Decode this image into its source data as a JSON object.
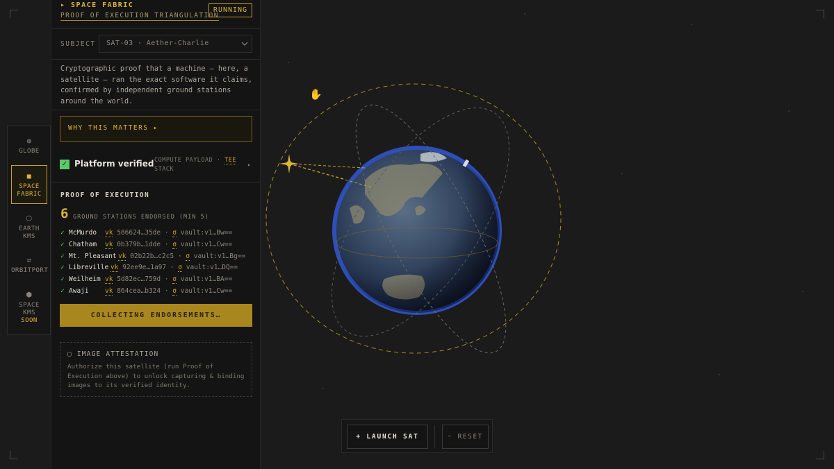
{
  "header": {
    "title": "▸ SPACE FABRIC",
    "subtitle": "PROOF OF EXECUTION TRIANGULATION",
    "status": "RUNNING"
  },
  "rail": {
    "items": [
      {
        "label": "GLOBE",
        "icon": "globe-icon",
        "glyph": "◍"
      },
      {
        "label": "SPACE FABRIC",
        "icon": "fabric-icon",
        "glyph": "■"
      },
      {
        "label": "EARTH KMS",
        "icon": "hexagon-icon",
        "glyph": "⬡"
      },
      {
        "label": "ORBITPORT",
        "icon": "swap-icon",
        "glyph": "⇄"
      },
      {
        "label": "SPACE KMS",
        "icon": "hexagon-filled-icon",
        "glyph": "⬢",
        "tag": "SOON"
      }
    ]
  },
  "subject": {
    "label": "SUBJECT",
    "value": "SAT-03 · Aether-Charlie"
  },
  "description": "Cryptographic proof that a machine — here, a satellite — ran the exact software it claims, confirmed by independent ground stations around the world.",
  "why_button": "WHY THIS MATTERS ▸",
  "platform": {
    "label": "Platform verified",
    "meta_prefix": "COMPUTE PAYLOAD ·",
    "meta_tee": "TEE",
    "meta_suffix": "STACK"
  },
  "proof": {
    "title": "PROOF OF EXECUTION",
    "count": "6",
    "count_label": "GROUND STATIONS ENDORSED (MIN 5)",
    "stations": [
      {
        "name": "McMurdo",
        "vk": "586624…35de",
        "vault": "vault:v1…Bw=="
      },
      {
        "name": "Chatham",
        "vk": "0b379b…1dde",
        "vault": "vault:v1…Cw=="
      },
      {
        "name": "Mt. Pleasant",
        "vk": "02b22b…c2c5",
        "vault": "vault:v1…Bg=="
      },
      {
        "name": "Libreville",
        "vk": "92ee9e…1a97",
        "vault": "vault:v1…DQ=="
      },
      {
        "name": "Weilheim",
        "vk": "5d82ec…759d",
        "vault": "vault:v1…BA=="
      },
      {
        "name": "Awaji",
        "vk": "864cea…b324",
        "vault": "vault:v1…Cw=="
      }
    ],
    "collect_button": "COLLECTING ENDORSEMENTS…"
  },
  "attestation": {
    "title": "▢ IMAGE ATTESTATION",
    "text": "Authorize this satellite (run Proof of Execution above) to unlock capturing & binding images to its verified identity."
  },
  "controls": {
    "launch": "+ LAUNCH SAT",
    "reset": "◦ RESET"
  },
  "colors": {
    "accent": "#d9b43a",
    "verified": "#5cc96a",
    "background": "#1b1b1b"
  }
}
